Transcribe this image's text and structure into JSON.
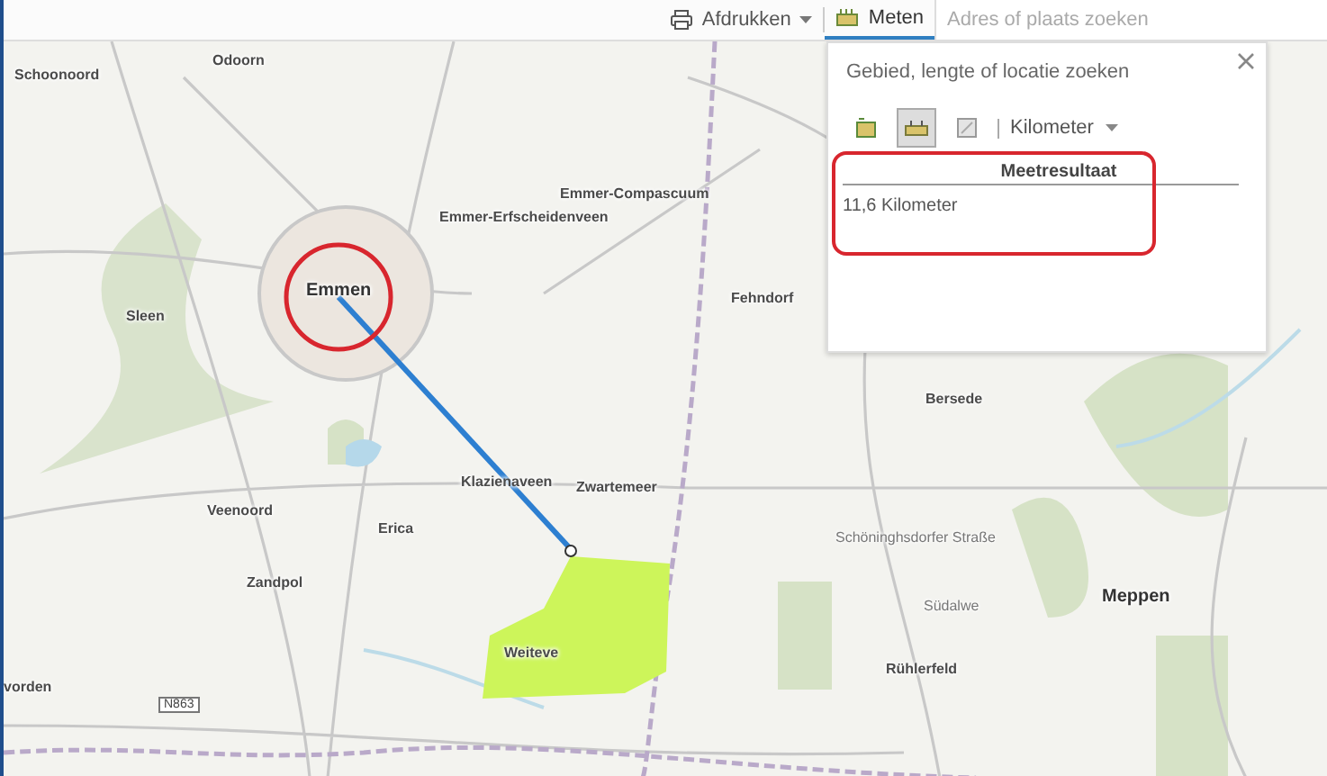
{
  "toolbar": {
    "print_button": {
      "label": "Afdrukken"
    },
    "measure_tab": {
      "label": "Meten",
      "selected": true
    },
    "search": {
      "placeholder": "Adres of plaats zoeken"
    }
  },
  "measure_panel": {
    "title": "Gebied, lengte of locatie zoeken",
    "tools": [
      {
        "kind": "area",
        "selected": false
      },
      {
        "kind": "distance",
        "selected": true
      },
      {
        "kind": "location",
        "selected": false
      }
    ],
    "unit": "Kilometer",
    "result_heading": "Meetresultaat",
    "result": "11,6 Kilometer"
  },
  "map": {
    "places": [
      {
        "name": "Schoonoord",
        "kind": "town"
      },
      {
        "name": "Odoorn",
        "kind": "town"
      },
      {
        "name": "Emmer-Compascuum",
        "kind": "town"
      },
      {
        "name": "Emmer-Erfscheidenveen",
        "kind": "town"
      },
      {
        "name": "Emmen",
        "kind": "city"
      },
      {
        "name": "Sleen",
        "kind": "town"
      },
      {
        "name": "Fehndorf",
        "kind": "town"
      },
      {
        "name": "Bersede",
        "kind": "town"
      },
      {
        "name": "Klazienaveen",
        "kind": "town"
      },
      {
        "name": "Zwartemeer",
        "kind": "town"
      },
      {
        "name": "Veenoord",
        "kind": "town"
      },
      {
        "name": "Erica",
        "kind": "town"
      },
      {
        "name": "Zandpol",
        "kind": "town"
      },
      {
        "name": "Schöninghsdorfer Straße",
        "kind": "street"
      },
      {
        "name": "Südalwe",
        "kind": "street"
      },
      {
        "name": "Meppen",
        "kind": "city"
      },
      {
        "name": "Weiteve",
        "kind": "town"
      },
      {
        "name": "vorden",
        "kind": "town"
      },
      {
        "name": "Rühlerfeld",
        "kind": "town"
      }
    ],
    "road_shield": "N863"
  }
}
